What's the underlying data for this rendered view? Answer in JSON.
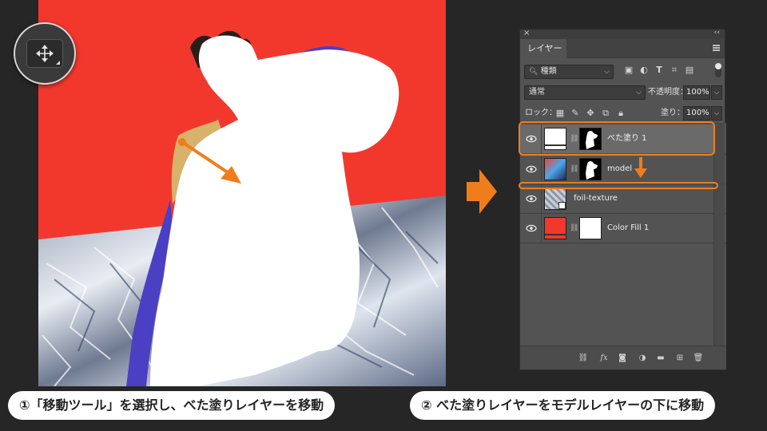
{
  "colors": {
    "accent": "#f07d1c",
    "canvas_red": "#f2382d",
    "panel_bg": "#535353",
    "selected_row": "#6a6a6a",
    "purple_stroke": "#4b3fc4",
    "gold_foil": "#d8b26a"
  },
  "toolbar": {
    "tool": "move-tool",
    "tool_icon": "move-arrows-icon"
  },
  "panel": {
    "close_glyph": "×",
    "collapse_glyph": "‹‹",
    "tab_label": "レイヤー",
    "filter": {
      "label": "種類",
      "icons": [
        "image-icon",
        "adjustment-icon",
        "type-icon",
        "shape-icon",
        "smart-object-icon"
      ]
    },
    "blend": {
      "mode": "通常",
      "opacity_label": "不透明度：",
      "opacity_value": "100%"
    },
    "lock": {
      "label": "ロック：",
      "fill_label": "塗り：",
      "fill_value": "100%"
    },
    "layers": [
      {
        "name": "べた塗り 1",
        "visible": true,
        "selected": true
      },
      {
        "name": "model",
        "visible": true,
        "selected": false
      },
      {
        "name": "foil-texture",
        "visible": true,
        "selected": false
      },
      {
        "name": "Color Fill 1",
        "visible": true,
        "selected": false
      }
    ],
    "footer_icons": [
      "link-layers-icon",
      "fx-icon",
      "mask-icon",
      "adjustment-layer-icon",
      "folder-icon",
      "new-layer-icon",
      "trash-icon"
    ],
    "fx_label": "fx"
  },
  "captions": {
    "step1": "①「移動ツール」を選択し、べた塗りレイヤーを移動",
    "step2": "② べた塗りレイヤーをモデルレイヤーの下に移動"
  }
}
